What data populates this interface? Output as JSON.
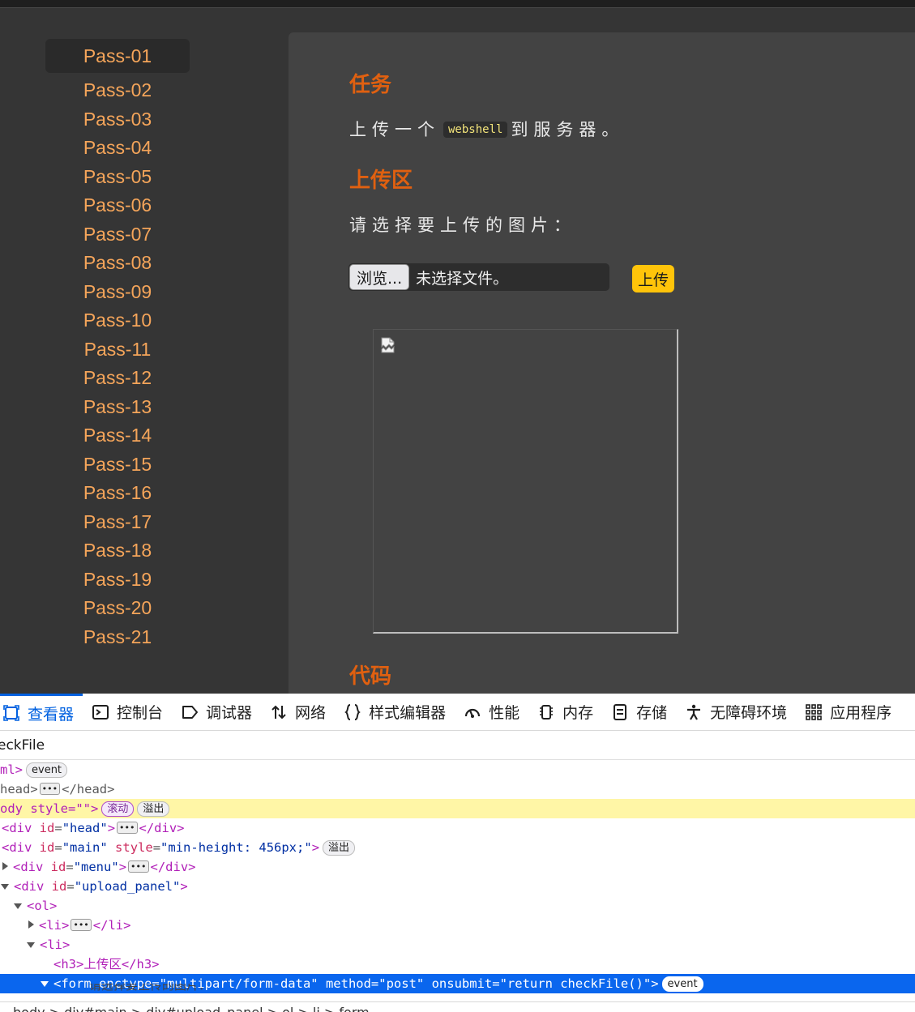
{
  "menu": {
    "items": [
      "Pass-01",
      "Pass-02",
      "Pass-03",
      "Pass-04",
      "Pass-05",
      "Pass-06",
      "Pass-07",
      "Pass-08",
      "Pass-09",
      "Pass-10",
      "Pass-11",
      "Pass-12",
      "Pass-13",
      "Pass-14",
      "Pass-15",
      "Pass-16",
      "Pass-17",
      "Pass-18",
      "Pass-19",
      "Pass-20",
      "Pass-21"
    ],
    "active_index": 0
  },
  "panel": {
    "task_title": "任务",
    "task_before": "上传一个",
    "task_code": "webshell",
    "task_after": "到服务器。",
    "upload_title": "上传区",
    "upload_prompt": "请选择要上传的图片：",
    "browse_label": "浏览...",
    "file_status": "未选择文件。",
    "upload_button": "上传",
    "code_title": "代码"
  },
  "colors": {
    "accent": "#e06010",
    "menu_text": "#f5a55a",
    "upload_button": "#ffc40a",
    "devtools_selection": "#0a66ee"
  },
  "devtools": {
    "tabs": [
      {
        "label": "查看器",
        "icon": "inspector-icon"
      },
      {
        "label": "控制台",
        "icon": "console-icon"
      },
      {
        "label": "调试器",
        "icon": "debugger-icon"
      },
      {
        "label": "网络",
        "icon": "network-icon"
      },
      {
        "label": "样式编辑器",
        "icon": "style-editor-icon"
      },
      {
        "label": "性能",
        "icon": "performance-icon"
      },
      {
        "label": "内存",
        "icon": "memory-icon"
      },
      {
        "label": "存储",
        "icon": "storage-icon"
      },
      {
        "label": "无障碍环境",
        "icon": "accessibility-icon"
      },
      {
        "label": "应用程序",
        "icon": "application-icon"
      }
    ],
    "search_value": "eckFile",
    "badges": {
      "event": "event",
      "scroll": "滚动",
      "overflow": "溢出"
    },
    "tree": {
      "html_open": "ml>",
      "head_open": "head>",
      "head_close": "</head>",
      "body_open": "ody style=\"\">",
      "div_open": "<div",
      "div_close": "</div>",
      "attr_id": "id",
      "attr_style": "style",
      "eq": "=",
      "gt": ">",
      "val_head": "\"head\"",
      "val_main": "\"main\"",
      "val_main_style": "\"min-height: 456px;\"",
      "val_menu": "\"menu\"",
      "val_upload_panel": "\"upload_panel\"",
      "ol_open": "<ol>",
      "li_open": "<li>",
      "li_close": "</li>",
      "h3_line": "<h3>上传区</h3>",
      "form_line": "<form enctype=\"multipart/form-data\" method=\"post\" onsubmit=\"return checkFile()\">",
      "cut_text": "请选择要上传的图片："
    },
    "breadcrumb": "body > div#main > div#upload_panel > ol > li > form"
  }
}
